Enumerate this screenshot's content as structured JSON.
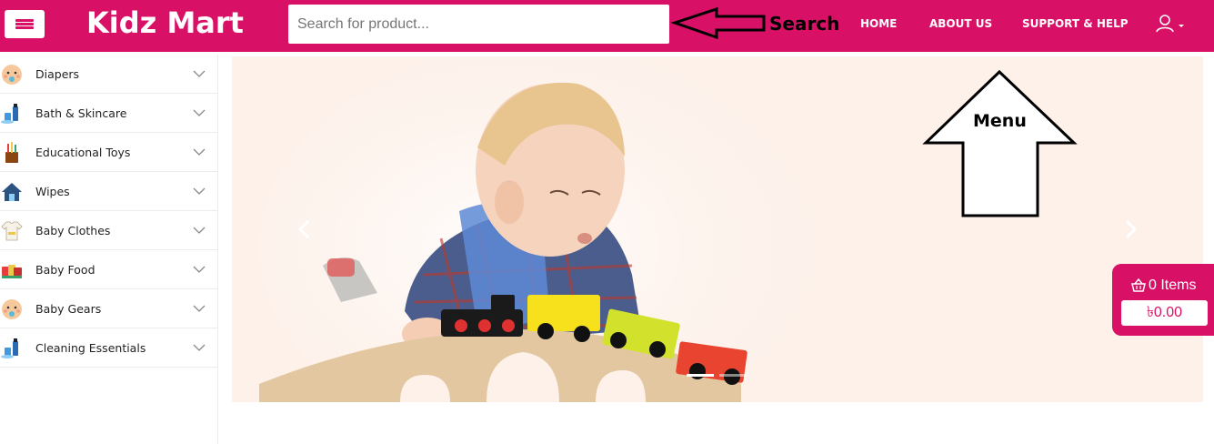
{
  "header": {
    "logo": "Kidz Mart",
    "search_placeholder": "Search for product...",
    "nav": [
      {
        "label": "HOME"
      },
      {
        "label": "ABOUT US"
      },
      {
        "label": "SUPPORT & HELP"
      }
    ],
    "account_icon": "user-icon",
    "menu_icon": "hamburger-icon"
  },
  "annotations": {
    "search_label": "Search",
    "menu_label": "Menu"
  },
  "sidebar": {
    "categories": [
      {
        "label": "Diapers",
        "icon": "baby-face-icon"
      },
      {
        "label": "Bath & Skincare",
        "icon": "bath-products-icon"
      },
      {
        "label": "Educational Toys",
        "icon": "crayons-icon"
      },
      {
        "label": "Wipes",
        "icon": "house-icon"
      },
      {
        "label": "Baby Clothes",
        "icon": "onesie-icon"
      },
      {
        "label": "Baby Food",
        "icon": "baby-food-icon"
      },
      {
        "label": "Baby Gears",
        "icon": "baby-face-icon"
      },
      {
        "label": "Cleaning Essentials",
        "icon": "bath-products-icon"
      }
    ]
  },
  "hero": {
    "image": "child-playing-with-toy-train",
    "slides_count": 2,
    "active_slide": 1
  },
  "cart": {
    "count_label": "0 Items",
    "total": "৳0.00",
    "icon": "basket-icon"
  },
  "colors": {
    "brand": "#d81166",
    "hero_bg": "#fdf1ea"
  }
}
